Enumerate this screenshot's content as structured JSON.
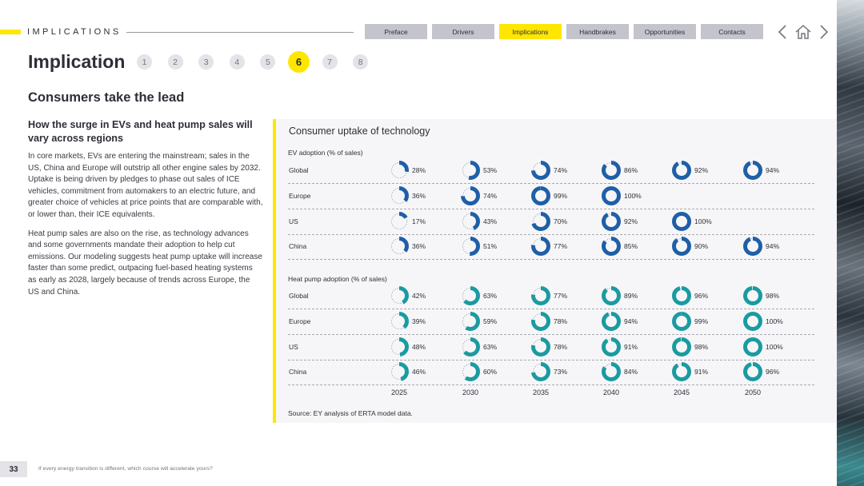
{
  "header": {
    "section": "IMPLICATIONS",
    "nav": [
      "Preface",
      "Drivers",
      "Implications",
      "Handbrakes",
      "Opportunities",
      "Contacts"
    ],
    "active_nav": "Implications"
  },
  "title": "Implication",
  "steps": [
    "1",
    "2",
    "3",
    "4",
    "5",
    "6",
    "7",
    "8"
  ],
  "active_step": "6",
  "subtitle": "Consumers take the lead",
  "left": {
    "heading": "How the surge in EVs and heat pump sales will vary across regions",
    "p1": "In core markets, EVs are entering the mainstream; sales in the US, China and Europe will outstrip all other engine sales by 2032. Uptake is being driven by pledges to phase out sales of ICE vehicles, commitment from automakers to an electric future, and greater choice of vehicles at price points that are comparable with, or lower than, their ICE equivalents.",
    "p2": "Heat pump sales are also on the rise, as technology advances and some governments mandate their adoption to help cut emissions. Our modeling suggests heat pump uptake will increase faster than some predict, outpacing fuel-based heating systems as early as 2028, largely because of trends across Europe, the US and China."
  },
  "chart_data": {
    "type": "donut-grid",
    "title": "Consumer uptake of technology",
    "years": [
      "2025",
      "2030",
      "2035",
      "2040",
      "2045",
      "2050"
    ],
    "groups": [
      {
        "label": "EV adoption (% of sales)",
        "color": "#1f5fa8",
        "rows": [
          {
            "region": "Global",
            "values": [
              28,
              53,
              74,
              86,
              92,
              94
            ]
          },
          {
            "region": "Europe",
            "values": [
              36,
              74,
              99,
              100,
              null,
              null
            ]
          },
          {
            "region": "US",
            "values": [
              17,
              43,
              70,
              92,
              100,
              null
            ]
          },
          {
            "region": "China",
            "values": [
              36,
              51,
              77,
              85,
              90,
              94
            ]
          }
        ]
      },
      {
        "label": "Heat pump adoption (% of sales)",
        "color": "#1a9ba1",
        "rows": [
          {
            "region": "Global",
            "values": [
              42,
              63,
              77,
              89,
              96,
              98
            ]
          },
          {
            "region": "Europe",
            "values": [
              39,
              59,
              78,
              94,
              99,
              100
            ]
          },
          {
            "region": "US",
            "values": [
              48,
              63,
              78,
              91,
              98,
              100
            ]
          },
          {
            "region": "China",
            "values": [
              46,
              60,
              73,
              84,
              91,
              96
            ]
          }
        ]
      }
    ],
    "source": "Source: EY analysis of ERTA model data."
  },
  "footer": {
    "page_number": "33",
    "text": "If every energy transition is different, which course will accelerate yours?"
  }
}
